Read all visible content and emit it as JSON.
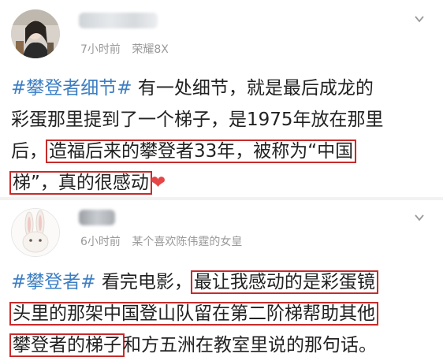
{
  "posts": [
    {
      "time": "7小时前",
      "device": "荣耀8X",
      "lines": [
        {
          "tag": "#攀登者细节#",
          "text": " 有一处细节，就是最后成龙的"
        },
        {
          "text": "彩蛋那里提到了一个梯子，是1975年放在那里"
        },
        {
          "pre": "后，",
          "hl": "造福后来的攀登者33年，被称为“中国"
        },
        {
          "hl": "梯”，真的很感动",
          "emoji": "❤"
        }
      ],
      "icons": [
        "avatar",
        "chevron-down-icon"
      ]
    },
    {
      "time": "6小时前",
      "device": "某个喜欢陈伟霆的女皇",
      "lines": [
        {
          "tag": "#攀登者#",
          "text": " 看完电影，",
          "hl": "最让我感动的是彩蛋镜"
        },
        {
          "hl": "头里的那架中国登山队留在第二阶梯帮助其他"
        },
        {
          "hl": "攀登者的梯子",
          "text": "和方五洲在教室里说的那句话。"
        }
      ],
      "icons": [
        "avatar",
        "chevron-down-icon"
      ]
    }
  ],
  "colors": {
    "tag": "#3d7fc4",
    "highlight_border": "#c72b2b",
    "meta": "#9a9a9a",
    "heart": "#e64545"
  }
}
